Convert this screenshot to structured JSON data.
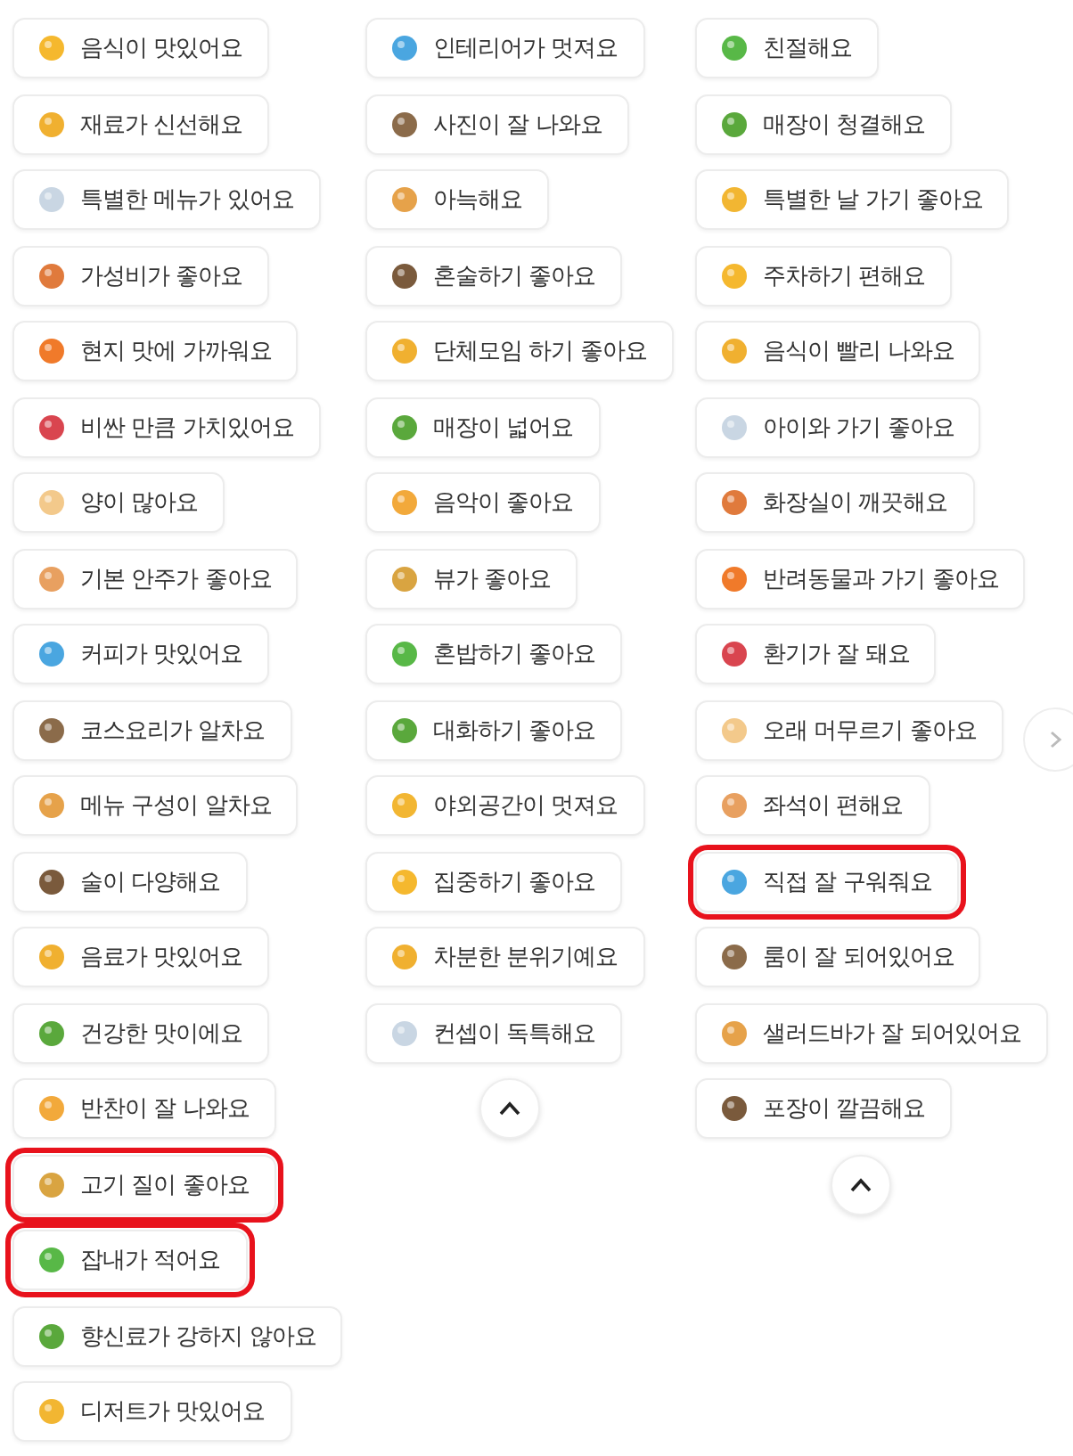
{
  "columns": [
    {
      "items": [
        {
          "label": "음식이 맛있어요",
          "highlighted": false
        },
        {
          "label": "재료가 신선해요",
          "highlighted": false
        },
        {
          "label": "특별한 메뉴가 있어요",
          "highlighted": false
        },
        {
          "label": "가성비가 좋아요",
          "highlighted": false
        },
        {
          "label": "현지 맛에 가까워요",
          "highlighted": false
        },
        {
          "label": "비싼 만큼 가치있어요",
          "highlighted": false
        },
        {
          "label": "양이 많아요",
          "highlighted": false
        },
        {
          "label": "기본 안주가 좋아요",
          "highlighted": false
        },
        {
          "label": "커피가 맛있어요",
          "highlighted": false
        },
        {
          "label": "코스요리가 알차요",
          "highlighted": false
        },
        {
          "label": "메뉴 구성이 알차요",
          "highlighted": false
        },
        {
          "label": "술이 다양해요",
          "highlighted": false
        },
        {
          "label": "음료가 맛있어요",
          "highlighted": false
        },
        {
          "label": "건강한 맛이에요",
          "highlighted": false
        },
        {
          "label": "반찬이 잘 나와요",
          "highlighted": false
        },
        {
          "label": "고기 질이 좋아요",
          "highlighted": true
        },
        {
          "label": "잡내가 적어요",
          "highlighted": true
        },
        {
          "label": "향신료가 강하지 않아요",
          "highlighted": false
        },
        {
          "label": "디저트가 맛있어요",
          "highlighted": false
        }
      ]
    },
    {
      "items": [
        {
          "label": "인테리어가 멋져요",
          "highlighted": false
        },
        {
          "label": "사진이 잘 나와요",
          "highlighted": false
        },
        {
          "label": "아늑해요",
          "highlighted": false
        },
        {
          "label": "혼술하기 좋아요",
          "highlighted": false
        },
        {
          "label": "단체모임 하기 좋아요",
          "highlighted": false
        },
        {
          "label": "매장이 넓어요",
          "highlighted": false
        },
        {
          "label": "음악이 좋아요",
          "highlighted": false
        },
        {
          "label": "뷰가 좋아요",
          "highlighted": false
        },
        {
          "label": "혼밥하기 좋아요",
          "highlighted": false
        },
        {
          "label": "대화하기 좋아요",
          "highlighted": false
        },
        {
          "label": "야외공간이 멋져요",
          "highlighted": false
        },
        {
          "label": "집중하기 좋아요",
          "highlighted": false
        },
        {
          "label": "차분한 분위기예요",
          "highlighted": false
        },
        {
          "label": "컨셉이 독특해요",
          "highlighted": false
        }
      ],
      "collapse_button": true
    },
    {
      "items": [
        {
          "label": "친절해요",
          "highlighted": false
        },
        {
          "label": "매장이 청결해요",
          "highlighted": false
        },
        {
          "label": "특별한 날 가기 좋아요",
          "highlighted": false
        },
        {
          "label": "주차하기 편해요",
          "highlighted": false
        },
        {
          "label": "음식이 빨리 나와요",
          "highlighted": false
        },
        {
          "label": "아이와 가기 좋아요",
          "highlighted": false
        },
        {
          "label": "화장실이 깨끗해요",
          "highlighted": false
        },
        {
          "label": "반려동물과 가기 좋아요",
          "highlighted": false
        },
        {
          "label": "환기가 잘 돼요",
          "highlighted": false
        },
        {
          "label": "오래 머무르기 좋아요",
          "highlighted": false
        },
        {
          "label": "좌석이 편해요",
          "highlighted": false
        },
        {
          "label": "직접 잘 구워줘요",
          "highlighted": true
        },
        {
          "label": "룸이 잘 되어있어요",
          "highlighted": false
        },
        {
          "label": "샐러드바가 잘 되어있어요",
          "highlighted": false
        },
        {
          "label": "포장이 깔끔해요",
          "highlighted": false
        }
      ],
      "collapse_button": true
    }
  ],
  "next_button": true
}
